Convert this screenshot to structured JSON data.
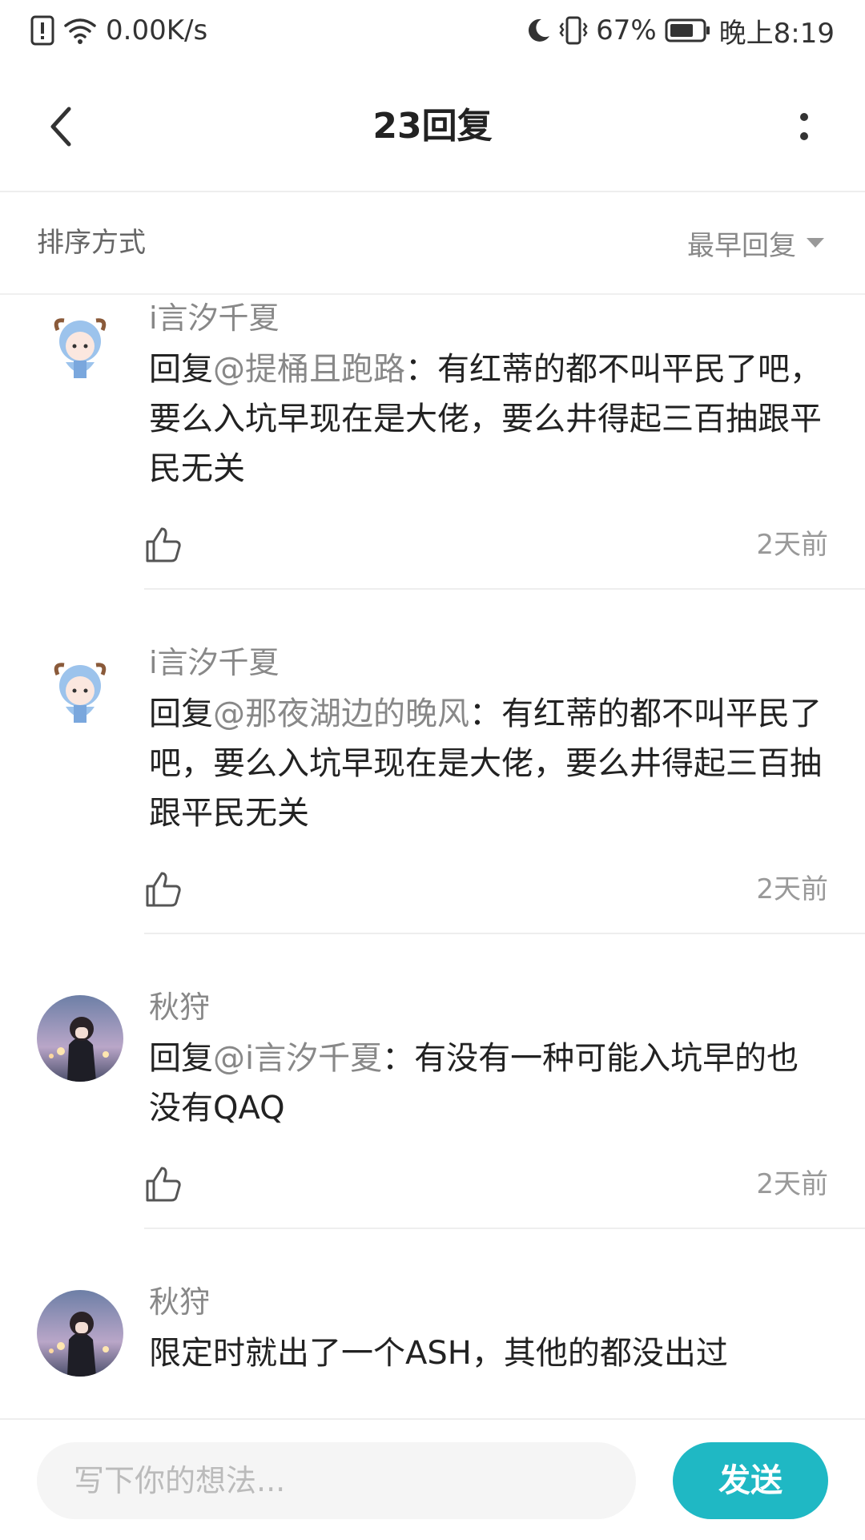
{
  "status_bar": {
    "speed": "0.00K/s",
    "battery": "67%",
    "time": "晚上8:19",
    "icons": [
      "alert-icon",
      "wifi-icon",
      "moon-icon",
      "vibrate-icon",
      "battery-icon"
    ]
  },
  "header": {
    "title": "23回复"
  },
  "sort": {
    "label": "排序方式",
    "value": "最早回复"
  },
  "comments": [
    {
      "author": "i言汐千夏",
      "prefix": "回复",
      "mention": "@提桶且跑路",
      "separator": "：",
      "text": "有红蒂的都不叫平民了吧，要么入坑早现在是大佬，要么井得起三百抽跟平民无关",
      "time": "2天前"
    },
    {
      "author": "i言汐千夏",
      "prefix": "回复",
      "mention": "@那夜湖边的晚风",
      "separator": "：",
      "text": "有红蒂的都不叫平民了吧，要么入坑早现在是大佬，要么井得起三百抽跟平民无关",
      "time": "2天前"
    },
    {
      "author": "秋狩",
      "prefix": "回复",
      "mention": "@i言汐千夏",
      "separator": "：",
      "text": "有没有一种可能入坑早的也没有QAQ",
      "time": "2天前"
    },
    {
      "author": "秋狩",
      "text": "限定时就出了一个ASH，其他的都没出过"
    }
  ],
  "composer": {
    "placeholder": "写下你的想法...",
    "send_label": "发送"
  },
  "colors": {
    "accent": "#1fb8c4",
    "muted": "#888888"
  }
}
